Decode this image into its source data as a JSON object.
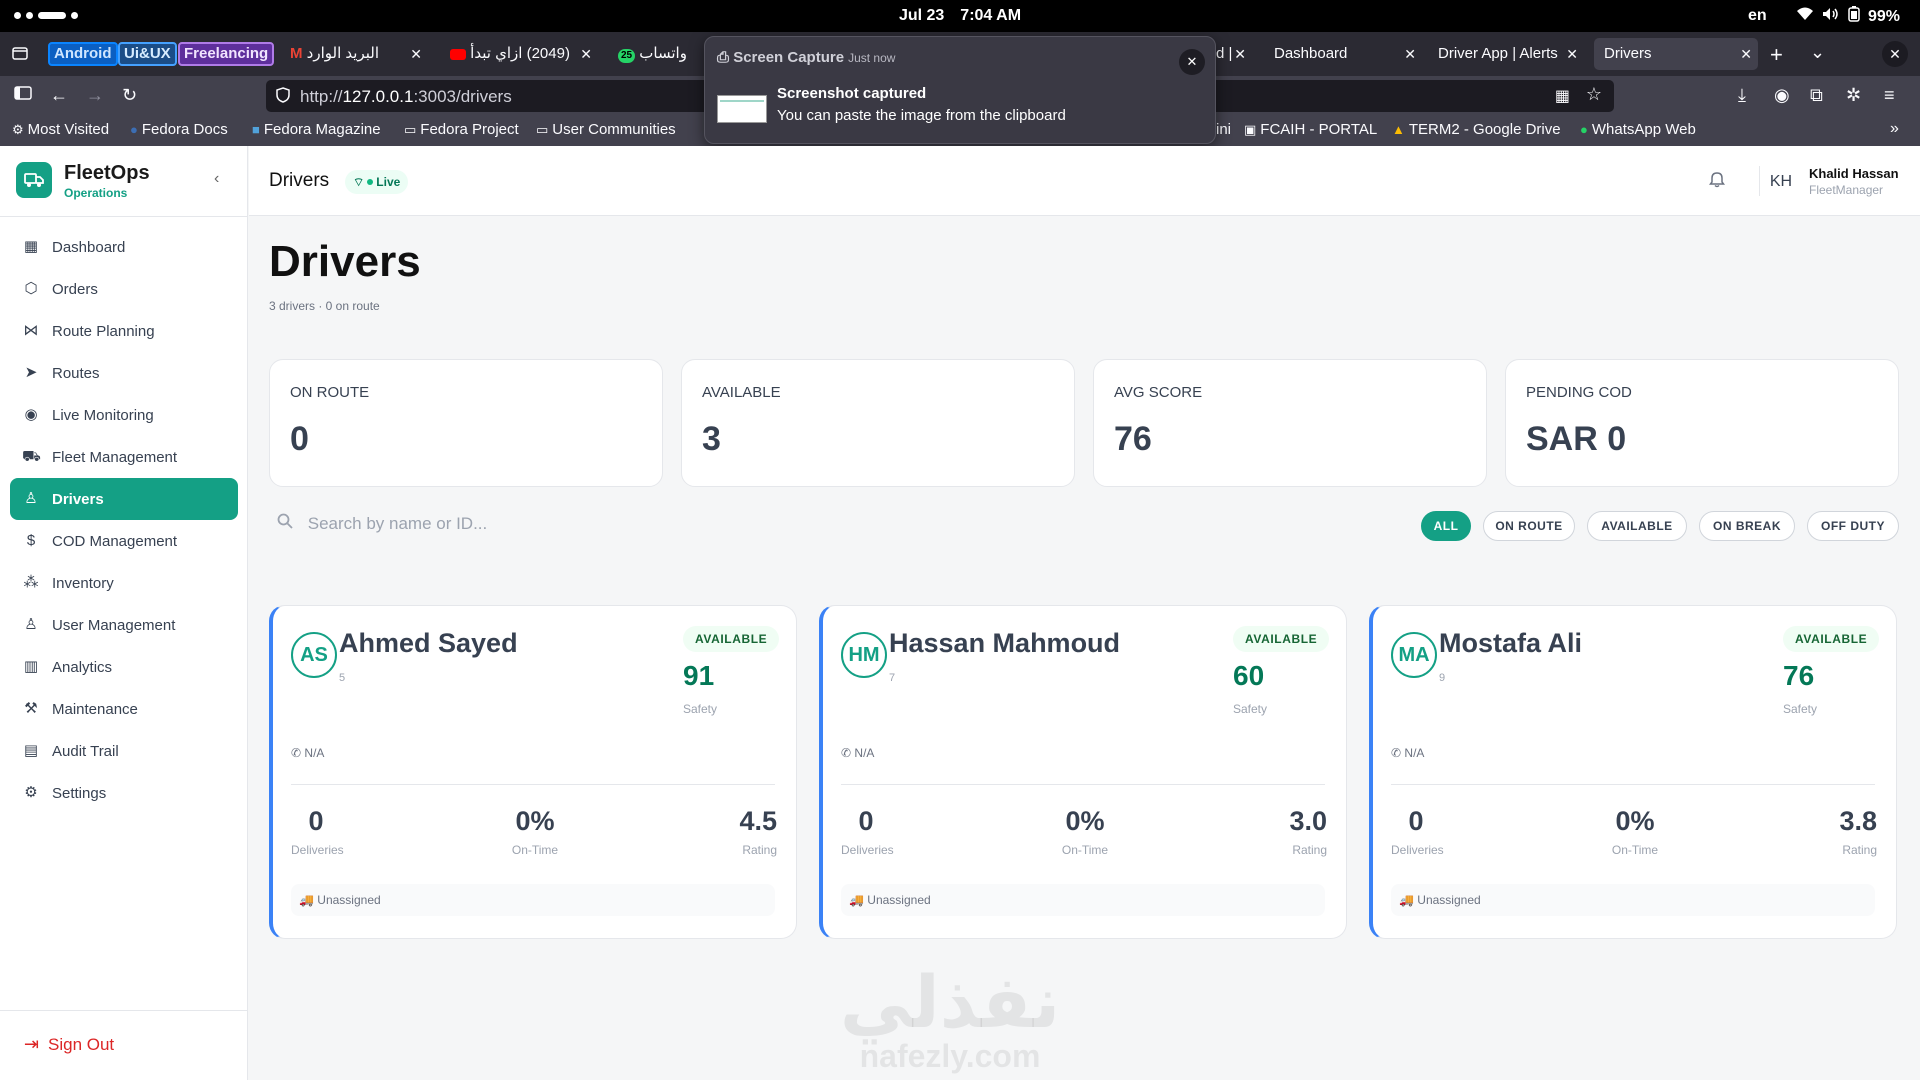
{
  "os": {
    "date": "Jul 23",
    "time": "7:04 AM",
    "lang": "en",
    "battery": "99%"
  },
  "browser": {
    "tab_groups": [
      "Android",
      "Ui&UX",
      "Freelancing"
    ],
    "tabs": [
      {
        "label": "البريد الوارد"
      },
      {
        "label": "(2049) ازاي تبدأ"
      },
      {
        "label": "واتساب"
      },
      {
        "label": "d |"
      },
      {
        "label": "Dashboard"
      },
      {
        "label": "Driver App | Alerts"
      },
      {
        "label": "Drivers"
      }
    ],
    "badge_25": "25",
    "url_prefix": "http://",
    "url_host": "127.0.0.1",
    "url_rest": ":3003/drivers",
    "bookmarks": [
      "Most Visited",
      "Fedora Docs",
      "Fedora Magazine",
      "Fedora Project",
      "User Communities",
      "ini",
      "FCAIH - PORTAL",
      "TERM2 - Google Drive",
      "WhatsApp Web"
    ]
  },
  "notification": {
    "app": "Screen Capture",
    "when": "Just now",
    "title": "Screenshot captured",
    "body": "You can paste the image from the clipboard"
  },
  "app": {
    "brand": "FleetOps",
    "brand_sub": "Operations",
    "nav": [
      {
        "label": "Dashboard",
        "icon": "grid-icon"
      },
      {
        "label": "Orders",
        "icon": "box-icon"
      },
      {
        "label": "Route Planning",
        "icon": "route-icon"
      },
      {
        "label": "Routes",
        "icon": "navigation-icon"
      },
      {
        "label": "Live Monitoring",
        "icon": "broadcast-icon"
      },
      {
        "label": "Fleet Management",
        "icon": "truck-icon"
      },
      {
        "label": "Drivers",
        "icon": "user-icon"
      },
      {
        "label": "COD Management",
        "icon": "dollar-icon"
      },
      {
        "label": "Inventory",
        "icon": "boxes-icon"
      },
      {
        "label": "User Management",
        "icon": "users-icon"
      },
      {
        "label": "Analytics",
        "icon": "chart-icon"
      },
      {
        "label": "Maintenance",
        "icon": "wrench-icon"
      },
      {
        "label": "Audit Trail",
        "icon": "clipboard-icon"
      },
      {
        "label": "Settings",
        "icon": "gear-icon"
      }
    ],
    "active_nav": "Drivers",
    "sign_out": "Sign Out",
    "header": {
      "crumb": "Drivers",
      "live": "Live",
      "user_initials": "KH",
      "user_name": "Khalid Hassan",
      "user_role": "FleetManager"
    },
    "page": {
      "title": "Drivers",
      "subtitle": "3 drivers · 0 on route"
    },
    "stats": [
      {
        "label": "ON ROUTE",
        "value": "0"
      },
      {
        "label": "AVAILABLE",
        "value": "3"
      },
      {
        "label": "AVG SCORE",
        "value": "76"
      },
      {
        "label": "PENDING COD",
        "value": "SAR 0"
      }
    ],
    "search_placeholder": "Search by name or ID...",
    "filters": [
      "ALL",
      "ON ROUTE",
      "AVAILABLE",
      "ON BREAK",
      "OFF DUTY"
    ],
    "active_filter": "ALL",
    "drivers": [
      {
        "initials": "AS",
        "name": "Ahmed Sayed",
        "id": "5",
        "status": "AVAILABLE",
        "score": "91",
        "score_label": "Safety",
        "phone": "N/A",
        "deliveries": "0",
        "deliveries_label": "Deliveries",
        "ontime": "0%",
        "ontime_label": "On-Time",
        "rating": "4.5",
        "rating_label": "Rating",
        "assignment": "Unassigned"
      },
      {
        "initials": "HM",
        "name": "Hassan Mahmoud",
        "id": "7",
        "status": "AVAILABLE",
        "score": "60",
        "score_label": "Safety",
        "phone": "N/A",
        "deliveries": "0",
        "deliveries_label": "Deliveries",
        "ontime": "0%",
        "ontime_label": "On-Time",
        "rating": "3.0",
        "rating_label": "Rating",
        "assignment": "Unassigned"
      },
      {
        "initials": "MA",
        "name": "Mostafa Ali",
        "id": "9",
        "status": "AVAILABLE",
        "score": "76",
        "score_label": "Safety",
        "phone": "N/A",
        "deliveries": "0",
        "deliveries_label": "Deliveries",
        "ontime": "0%",
        "ontime_label": "On-Time",
        "rating": "3.8",
        "rating_label": "Rating",
        "assignment": "Unassigned"
      }
    ]
  },
  "watermark": {
    "arabic": "نفذلي",
    "latin": "nafezly.com"
  }
}
